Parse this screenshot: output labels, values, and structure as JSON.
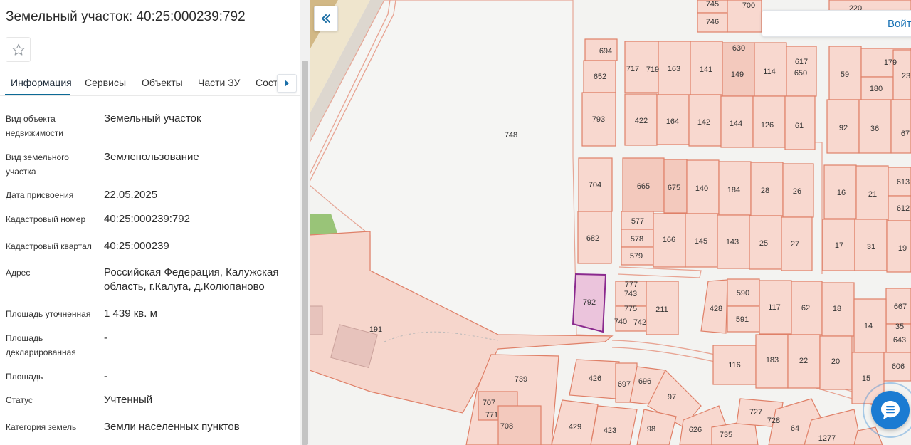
{
  "panel": {
    "title": "Земельный участок: 40:25:000239:792",
    "tabs": [
      {
        "label": "Информация",
        "active": true
      },
      {
        "label": "Сервисы"
      },
      {
        "label": "Объекты"
      },
      {
        "label": "Части ЗУ"
      },
      {
        "label": "Соста"
      }
    ],
    "properties": [
      {
        "label": "Вид объекта недвижимости",
        "value": "Земельный участок"
      },
      {
        "label": "Вид земельного участка",
        "value": "Землепользование"
      },
      {
        "label": "Дата присвоения",
        "value": "22.05.2025"
      },
      {
        "label": "Кадастровый номер",
        "value": "40:25:000239:792"
      },
      {
        "label": "Кадастровый квартал",
        "value": "40:25:000239"
      },
      {
        "label": "Адрес",
        "value": "Российская Федерация, Калужская область, г.Калуга, д.Колюпаново"
      },
      {
        "label": "Площадь уточненная",
        "value": "1 439 кв. м"
      },
      {
        "label": "Площадь декларированная",
        "value": "-"
      },
      {
        "label": "Площадь",
        "value": "-"
      },
      {
        "label": "Статус",
        "value": "Учтенный"
      },
      {
        "label": "Категория земель",
        "value": "Земли населенных пунктов"
      }
    ]
  },
  "map": {
    "login_label": "Войт",
    "collapse_icon": "double-chevron-left-icon",
    "chat_icon": "chat-icon",
    "colors": {
      "parcel_fill": "#f9d9d1",
      "parcel_stroke": "#e07a63",
      "selected_fill": "#ebc4dc",
      "selected_stroke": "#8a2a8e",
      "green": "#8fbf6a",
      "road": "#c9a96a"
    },
    "selected_parcel": "792",
    "parcel_labels": [
      "745",
      "700",
      "746",
      "220",
      "694",
      "652",
      "717",
      "719",
      "163",
      "141",
      "630",
      "149",
      "114",
      "617",
      "650",
      "59",
      "179",
      "180",
      "23",
      "793",
      "422",
      "164",
      "142",
      "144",
      "126",
      "61",
      "92",
      "36",
      "67",
      "748",
      "704",
      "665",
      "675",
      "140",
      "184",
      "28",
      "26",
      "16",
      "21",
      "613",
      "612",
      "577",
      "578",
      "579",
      "682",
      "166",
      "145",
      "143",
      "25",
      "27",
      "17",
      "31",
      "19",
      "777",
      "743",
      "775",
      "740",
      "742",
      "792",
      "211",
      "590",
      "591",
      "428",
      "117",
      "62",
      "18",
      "667",
      "35",
      "643",
      "14",
      "191",
      "116",
      "183",
      "22",
      "20",
      "15",
      "606",
      "739",
      "426",
      "697",
      "696",
      "97",
      "707",
      "771",
      "708",
      "429",
      "423",
      "98",
      "626",
      "735",
      "727",
      "728",
      "64",
      "1277"
    ]
  }
}
